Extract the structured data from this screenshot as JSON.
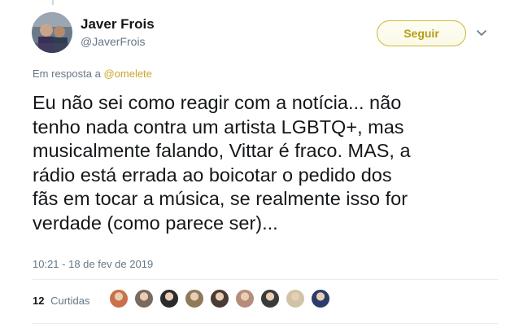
{
  "author": {
    "name": "Javer Frois",
    "handle": "@JaverFrois",
    "avatar_icon": "user-avatar-photo"
  },
  "follow_button": {
    "label": "Seguir",
    "color": "#b79d18"
  },
  "menu_icon": "chevron-down-icon",
  "reply": {
    "prefix": "Em resposta a",
    "mention": "@omelete",
    "mention_color": "#c9a628"
  },
  "tweet": {
    "text": "Eu não sei como reagir com a notícia... não\ntenho nada contra um artista LGBTQ+, mas\nmusicalmente falando, Vittar é fraco. MAS, a\nrádio está errada ao boicotar o pedido dos\nfãs em tocar a música, se realmente isso for\nverdade (como parece ser)..."
  },
  "timestamp": "10:21 - 18 de fev de 2019",
  "likes": {
    "count": "12",
    "label": "Curtidas",
    "liker_avatars": [
      "#c9714a",
      "#7a6a5d",
      "#2b2b2b",
      "#8e7a5a",
      "#4a3b34",
      "#b58d7a",
      "#3a3a3a",
      "#cfc4a8",
      "#2a3d6a"
    ]
  }
}
